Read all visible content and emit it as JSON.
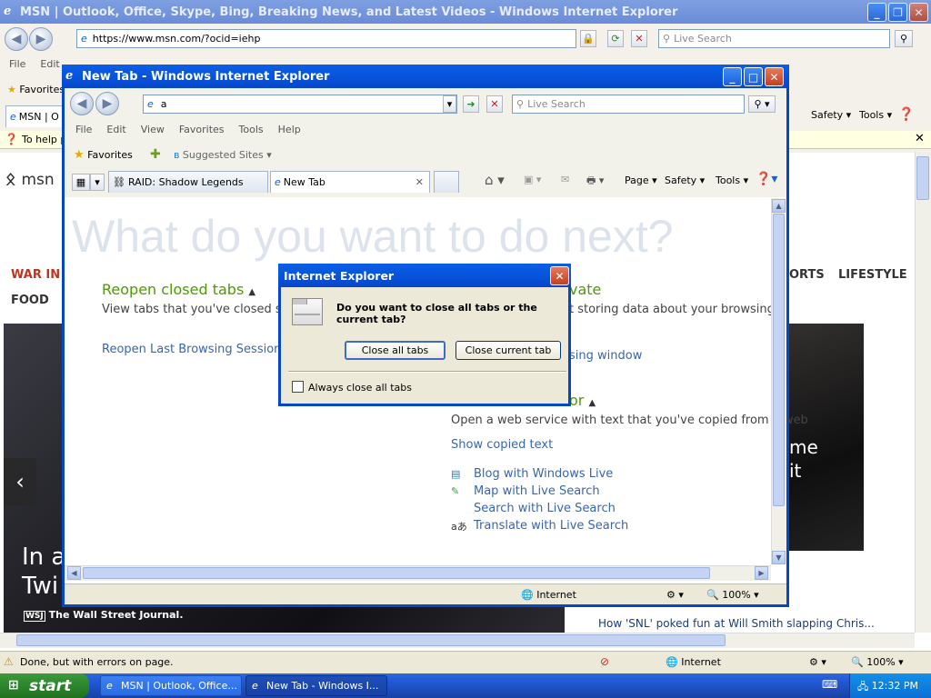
{
  "outer": {
    "title": "MSN | Outlook, Office, Skype, Bing, Breaking News, and Latest Videos - Windows Internet Explorer",
    "url": "https://www.msn.com/?ocid=iehp",
    "search_placeholder": "Live Search",
    "menu": [
      "File",
      "Edit"
    ],
    "favorites_label": "Favorites",
    "tab_label": "MSN | O",
    "infobar_text": "To help p",
    "toolbar": {
      "safety": "Safety",
      "tools": "Tools"
    },
    "msn_logo_text": "msn",
    "nav_left": "WAR IN U",
    "nav_food": "FOOD",
    "nav_right_1": "ORTS",
    "nav_right_2": "LIFESTYLE",
    "hero_text_1": "In a",
    "hero_text_2": "Twi",
    "hero_right_1": "me",
    "hero_right_2": "it",
    "wsj_label": "The Wall Street Journal.",
    "headline": "How 'SNL' poked fun at Will Smith slapping Chris...",
    "status_text": "Done, but with errors on page.",
    "zone": "Internet",
    "zoom": "100%"
  },
  "inner": {
    "title": "New Tab - Windows Internet Explorer",
    "address_value": "a",
    "search_placeholder": "Live Search",
    "menu": [
      "File",
      "Edit",
      "View",
      "Favorites",
      "Tools",
      "Help"
    ],
    "favorites_label": "Favorites",
    "suggested_sites": "Suggested Sites",
    "tabs": [
      "RAID: Shadow Legends",
      "New Tab"
    ],
    "toolbar": {
      "page": "Page",
      "safety": "Safety",
      "tools": "Tools"
    },
    "heading": "What do you want to do next?",
    "reopen_title": "Reopen closed tabs",
    "reopen_desc": "View tabs that you've closed since",
    "reopen_last": "Reopen Last Browsing Session",
    "private_title": "vate",
    "private_desc": "t storing data about your browsing",
    "private_link": "sing window",
    "accel_title": "or",
    "accel_desc": "Open a web service with text that you've copied from a web",
    "show_copied": "Show copied text",
    "accelerators": [
      "Blog with Windows Live",
      "Map with Live Search",
      "Search with Live Search",
      "Translate with Live Search"
    ],
    "zone": "Internet",
    "zoom": "100%"
  },
  "dialog": {
    "title": "Internet Explorer",
    "question": "Do you want to close all tabs or the current tab?",
    "close_all": "Close all tabs",
    "close_current": "Close current tab",
    "always_label": "Always close all tabs",
    "always_checked": false
  },
  "taskbar": {
    "start": "start",
    "tasks": [
      "MSN | Outlook, Office...",
      "New Tab - Windows I..."
    ],
    "clock": "12:32 PM"
  },
  "colors": {
    "xp_blue": "#0646c9",
    "start_green": "#2f8a2f",
    "link_blue": "#3a66a8",
    "section_green": "#4e9a06",
    "msn_red": "#c0341c"
  }
}
